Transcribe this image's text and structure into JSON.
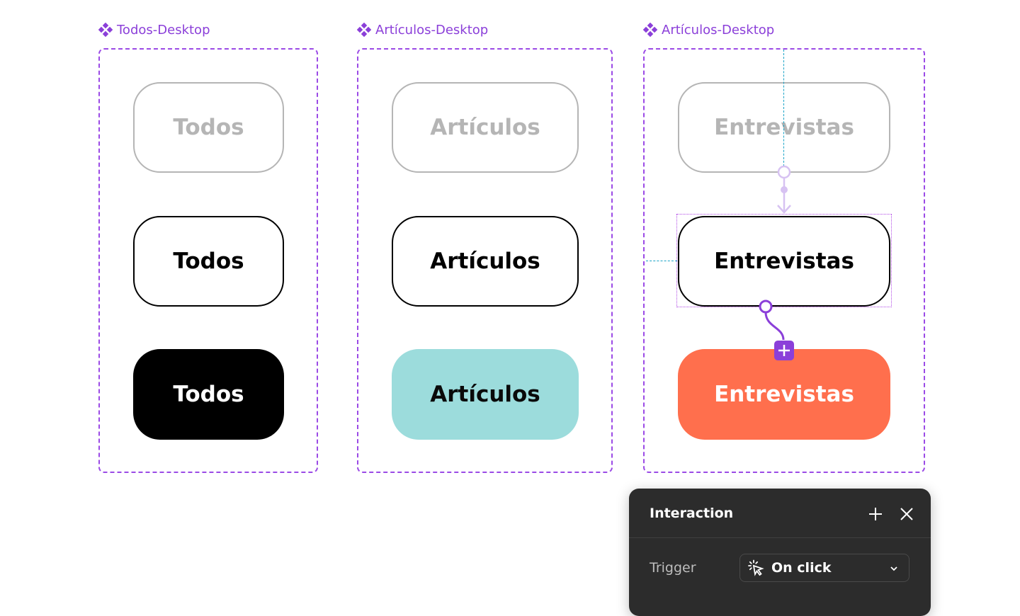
{
  "component_sets": [
    {
      "name": "Todos-Desktop",
      "variants": [
        {
          "label": "Todos",
          "state": "default"
        },
        {
          "label": "Todos",
          "state": "hover"
        },
        {
          "label": "Todos",
          "state": "active"
        }
      ]
    },
    {
      "name": "Artículos-Desktop",
      "variants": [
        {
          "label": "Artículos",
          "state": "default"
        },
        {
          "label": "Artículos",
          "state": "hover"
        },
        {
          "label": "Artículos",
          "state": "active"
        }
      ]
    },
    {
      "name": "Artículos-Desktop",
      "variants": [
        {
          "label": "Entrevistas",
          "state": "default"
        },
        {
          "label": "Entrevistas",
          "state": "hover"
        },
        {
          "label": "Entrevistas",
          "state": "active"
        }
      ]
    }
  ],
  "colors": {
    "component_purple": "#9b4ae6",
    "guide_blue": "#1aa3c7",
    "teal": "#9cdcdc",
    "orange": "#ff6f4d",
    "panel_bg": "#2c2c2c"
  },
  "interaction_panel": {
    "title": "Interaction",
    "add_icon": "plus-icon",
    "close_icon": "close-icon",
    "trigger_label": "Trigger",
    "trigger_value": "On click",
    "trigger_icon": "click-icon"
  }
}
